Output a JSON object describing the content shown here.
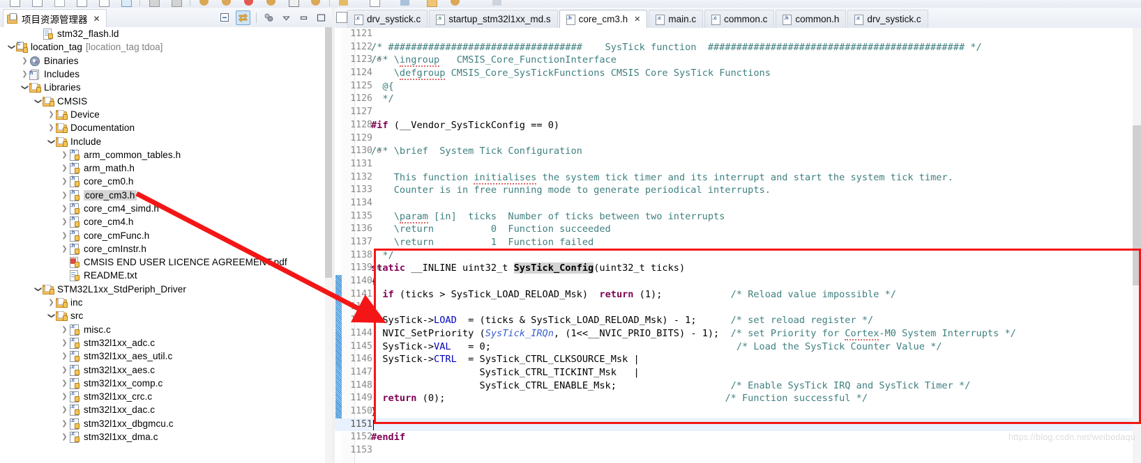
{
  "window": {
    "toolbar_hint": "eclipse-toolbar-strip"
  },
  "explorer": {
    "tab_label": "项目资源管理器",
    "tab_close_glyph": "✕",
    "tools": [
      {
        "name": "collapse-all",
        "title": "Collapse All"
      },
      {
        "name": "link-with-editor",
        "title": "Link with Editor",
        "active": true
      },
      {
        "name": "focus-on-active-task",
        "title": "Focus on Active Task"
      },
      {
        "name": "view-menu",
        "title": "View Menu"
      },
      {
        "name": "minimize",
        "title": "Minimize"
      },
      {
        "name": "maximize",
        "title": "Maximize"
      }
    ],
    "tree": [
      {
        "label": "stm32_flash.ld",
        "indent": 2,
        "arrow": "none",
        "icon": "ld-file",
        "selected": false
      },
      {
        "label": "location_tag",
        "suffix": "[location_tag tdoa]",
        "indent": 0,
        "arrow": "open",
        "icon": "project",
        "selected": false
      },
      {
        "label": "Binaries",
        "indent": 1,
        "arrow": "closed",
        "icon": "binaries",
        "selected": false
      },
      {
        "label": "Includes",
        "indent": 1,
        "arrow": "closed",
        "icon": "includes",
        "selected": false
      },
      {
        "label": "Libraries",
        "indent": 1,
        "arrow": "open",
        "icon": "folder-lib",
        "selected": false
      },
      {
        "label": "CMSIS",
        "indent": 2,
        "arrow": "open",
        "icon": "folder",
        "selected": false
      },
      {
        "label": "Device",
        "indent": 3,
        "arrow": "closed",
        "icon": "folder",
        "selected": false
      },
      {
        "label": "Documentation",
        "indent": 3,
        "arrow": "closed",
        "icon": "folder",
        "selected": false
      },
      {
        "label": "Include",
        "indent": 3,
        "arrow": "open",
        "icon": "folder",
        "selected": false
      },
      {
        "label": "arm_common_tables.h",
        "indent": 4,
        "arrow": "closed",
        "icon": "h-file",
        "selected": false
      },
      {
        "label": "arm_math.h",
        "indent": 4,
        "arrow": "closed",
        "icon": "h-file",
        "selected": false
      },
      {
        "label": "core_cm0.h",
        "indent": 4,
        "arrow": "closed",
        "icon": "h-file",
        "selected": false
      },
      {
        "label": "core_cm3.h",
        "indent": 4,
        "arrow": "closed",
        "icon": "h-file",
        "selected": true
      },
      {
        "label": "core_cm4_simd.h",
        "indent": 4,
        "arrow": "closed",
        "icon": "h-file",
        "selected": false
      },
      {
        "label": "core_cm4.h",
        "indent": 4,
        "arrow": "closed",
        "icon": "h-file",
        "selected": false
      },
      {
        "label": "core_cmFunc.h",
        "indent": 4,
        "arrow": "closed",
        "icon": "h-file",
        "selected": false
      },
      {
        "label": "core_cmInstr.h",
        "indent": 4,
        "arrow": "closed",
        "icon": "h-file",
        "selected": false
      },
      {
        "label": "CMSIS END USER LICENCE AGREEMENT.pdf",
        "indent": 4,
        "arrow": "none",
        "icon": "pdf-file",
        "selected": false
      },
      {
        "label": "README.txt",
        "indent": 4,
        "arrow": "none",
        "icon": "txt-file",
        "selected": false
      },
      {
        "label": "STM32L1xx_StdPeriph_Driver",
        "indent": 2,
        "arrow": "open",
        "icon": "folder",
        "selected": false
      },
      {
        "label": "inc",
        "indent": 3,
        "arrow": "closed",
        "icon": "folder",
        "selected": false
      },
      {
        "label": "src",
        "indent": 3,
        "arrow": "open",
        "icon": "folder",
        "selected": false
      },
      {
        "label": "misc.c",
        "indent": 4,
        "arrow": "closed",
        "icon": "c-file",
        "selected": false
      },
      {
        "label": "stm32l1xx_adc.c",
        "indent": 4,
        "arrow": "closed",
        "icon": "c-file",
        "selected": false
      },
      {
        "label": "stm32l1xx_aes_util.c",
        "indent": 4,
        "arrow": "closed",
        "icon": "c-file",
        "selected": false
      },
      {
        "label": "stm32l1xx_aes.c",
        "indent": 4,
        "arrow": "closed",
        "icon": "c-file",
        "selected": false
      },
      {
        "label": "stm32l1xx_comp.c",
        "indent": 4,
        "arrow": "closed",
        "icon": "c-file",
        "selected": false
      },
      {
        "label": "stm32l1xx_crc.c",
        "indent": 4,
        "arrow": "closed",
        "icon": "c-file",
        "selected": false
      },
      {
        "label": "stm32l1xx_dac.c",
        "indent": 4,
        "arrow": "closed",
        "icon": "c-file",
        "selected": false
      },
      {
        "label": "stm32l1xx_dbgmcu.c",
        "indent": 4,
        "arrow": "closed",
        "icon": "c-file",
        "selected": false
      },
      {
        "label": "stm32l1xx_dma.c",
        "indent": 4,
        "arrow": "closed",
        "icon": "c-file",
        "selected": false
      }
    ]
  },
  "editor": {
    "tabs": [
      {
        "label": "drv_systick.c",
        "kind": "c",
        "active": false,
        "closable": false
      },
      {
        "label": "startup_stm32l1xx_md.s",
        "kind": "s",
        "active": false,
        "closable": false
      },
      {
        "label": "core_cm3.h",
        "kind": "h",
        "active": true,
        "closable": true
      },
      {
        "label": "main.c",
        "kind": "c",
        "active": false,
        "closable": false
      },
      {
        "label": "common.c",
        "kind": "c",
        "active": false,
        "closable": false
      },
      {
        "label": "common.h",
        "kind": "h",
        "active": false,
        "closable": false
      },
      {
        "label": "drv_systick.c",
        "kind": "c",
        "active": false,
        "closable": false
      }
    ],
    "tab_close_glyph": "✕",
    "first_line_number": 1121,
    "current_line": 1151,
    "lines": [
      {
        "n": 1121,
        "fold": "",
        "text": ""
      },
      {
        "n": 1122,
        "fold": "",
        "text": "/* ##################################    SysTick function  ############################################# */",
        "style": "comment"
      },
      {
        "n": 1123,
        "fold": "minus",
        "text": "/** \\ingroup   CMSIS_Core_FunctionInterface",
        "style": "comment-ingroup"
      },
      {
        "n": 1124,
        "fold": "",
        "text": "    \\defgroup CMSIS_Core_SysTickFunctions CMSIS Core SysTick Functions",
        "style": "comment-defgroup"
      },
      {
        "n": 1125,
        "fold": "",
        "text": "  @{",
        "style": "comment"
      },
      {
        "n": 1126,
        "fold": "",
        "text": "  */",
        "style": "comment"
      },
      {
        "n": 1127,
        "fold": "",
        "text": ""
      },
      {
        "n": 1128,
        "fold": "",
        "text": "#if (__Vendor_SysTickConfig == 0)",
        "style": "preproc-if"
      },
      {
        "n": 1129,
        "fold": "",
        "text": ""
      },
      {
        "n": 1130,
        "fold": "minus",
        "text": "/** \\brief  System Tick Configuration",
        "style": "comment"
      },
      {
        "n": 1131,
        "fold": "",
        "text": ""
      },
      {
        "n": 1132,
        "fold": "",
        "text": "    This function initialises the system tick timer and its interrupt and start the system tick timer.",
        "style": "comment-spell-initialises"
      },
      {
        "n": 1133,
        "fold": "",
        "text": "    Counter is in free running mode to generate periodical interrupts.",
        "style": "comment"
      },
      {
        "n": 1134,
        "fold": "",
        "text": ""
      },
      {
        "n": 1135,
        "fold": "",
        "text": "    \\param [in]  ticks  Number of ticks between two interrupts",
        "style": "comment-spell-param"
      },
      {
        "n": 1136,
        "fold": "",
        "text": "    \\return          0  Function succeeded",
        "style": "comment"
      },
      {
        "n": 1137,
        "fold": "",
        "text": "    \\return          1  Function failed",
        "style": "comment"
      },
      {
        "n": 1138,
        "fold": "",
        "text": "  */",
        "style": "comment"
      },
      {
        "n": 1139,
        "fold": "minus",
        "text": "static __INLINE uint32_t SysTick_Config(uint32_t ticks)",
        "style": "decl"
      },
      {
        "n": 1140,
        "fold": "",
        "text": "{",
        "style": "plain"
      },
      {
        "n": 1141,
        "fold": "",
        "text": "  if (ticks > SysTick_LOAD_RELOAD_Msk)  return (1);            /* Reload value impossible */",
        "style": "if-return"
      },
      {
        "n": 1142,
        "fold": "",
        "text": ""
      },
      {
        "n": 1143,
        "fold": "",
        "text": "  SysTick->LOAD  = (ticks & SysTick_LOAD_RELOAD_Msk) - 1;      /* set reload register */",
        "style": "load"
      },
      {
        "n": 1144,
        "fold": "",
        "text": "  NVIC_SetPriority (SysTick_IRQn, (1<<__NVIC_PRIO_BITS) - 1);  /* set Priority for Cortex-M0 System Interrupts */",
        "style": "nvic"
      },
      {
        "n": 1145,
        "fold": "",
        "text": "  SysTick->VAL   = 0;                                          /* Load the SysTick Counter Value */",
        "style": "val"
      },
      {
        "n": 1146,
        "fold": "",
        "text": "  SysTick->CTRL  = SysTick_CTRL_CLKSOURCE_Msk |",
        "style": "ctrl"
      },
      {
        "n": 1147,
        "fold": "",
        "text": "                   SysTick_CTRL_TICKINT_Msk   |",
        "style": "plain"
      },
      {
        "n": 1148,
        "fold": "",
        "text": "                   SysTick_CTRL_ENABLE_Msk;                    /* Enable SysTick IRQ and SysTick Timer */",
        "style": "enable"
      },
      {
        "n": 1149,
        "fold": "",
        "text": "  return (0);                                                  /* Function successful */",
        "style": "ret0"
      },
      {
        "n": 1150,
        "fold": "",
        "text": "}",
        "style": "plain"
      },
      {
        "n": 1151,
        "fold": "",
        "text": "",
        "style": "plain"
      },
      {
        "n": 1152,
        "fold": "",
        "text": "#endif",
        "style": "preproc"
      },
      {
        "n": 1153,
        "fold": "",
        "text": ""
      }
    ],
    "inline_comments": {
      "reload_impossible": "/* Reload value impossible */",
      "set_reload_register": "/* set reload register */",
      "set_priority": "/* set Priority for Cortex-M0 System Interrupts */",
      "load_counter": "/* Load the SysTick Counter Value */",
      "enable_systick": "/* Enable SysTick IRQ and SysTick Timer */",
      "function_successful": "/* Function successful */"
    }
  },
  "annotations": {
    "highlight_box_color": "#f41616",
    "arrow_color": "#f41616",
    "arrow_from": "core_cm3.h tree node",
    "arrow_to": "SysTick_Config code block"
  },
  "watermark": {
    "text": "https://blog.csdn.net/weibodaqu"
  },
  "colors": {
    "comment": "#3f7f7f",
    "keyword": "#7f0055",
    "field": "#0000c0",
    "enum": "#3a5fcd",
    "selection": "#d4d4d4",
    "current_line": "#e8f1fd",
    "change_bar": "#2f86cf"
  }
}
